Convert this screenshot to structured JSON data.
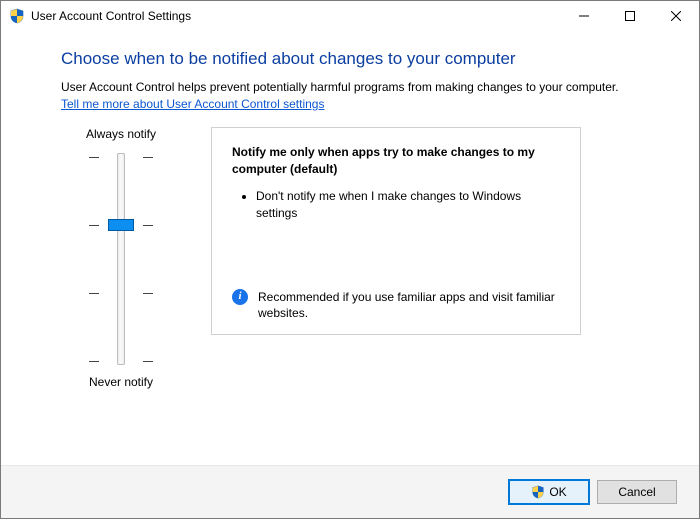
{
  "window": {
    "title": "User Account Control Settings"
  },
  "content": {
    "heading": "Choose when to be notified about changes to your computer",
    "description": "User Account Control helps prevent potentially harmful programs from making changes to your computer.",
    "link_text": "Tell me more about User Account Control settings"
  },
  "slider": {
    "top_label": "Always notify",
    "bottom_label": "Never notify",
    "levels": 4,
    "current_level_index": 1
  },
  "panel": {
    "title": "Notify me only when apps try to make changes to my computer (default)",
    "bullet1": "Don't notify me when I make changes to Windows settings",
    "recommendation": "Recommended if you use familiar apps and visit familiar websites."
  },
  "buttons": {
    "ok": "OK",
    "cancel": "Cancel"
  },
  "icons": {
    "info_glyph": "i"
  }
}
